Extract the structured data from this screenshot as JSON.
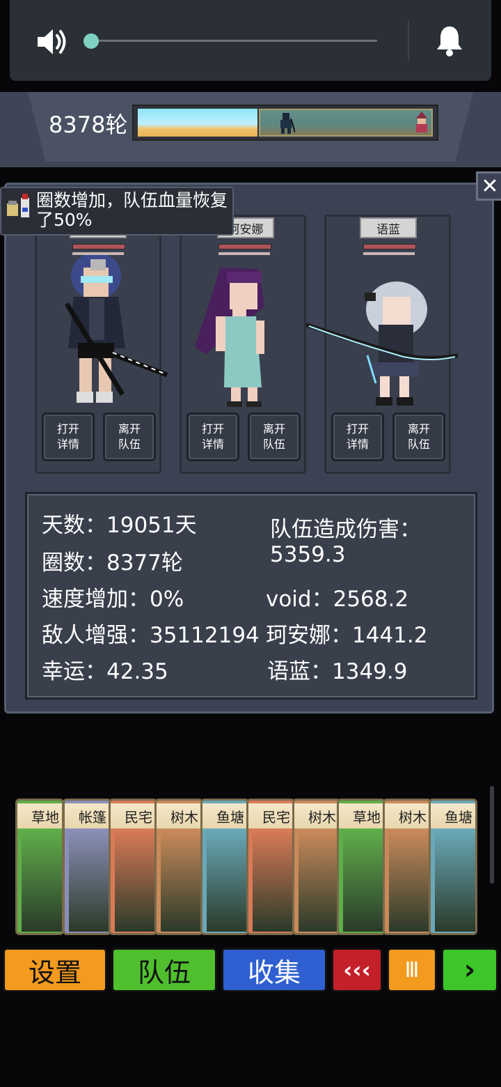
{
  "volume": {
    "level": 0.02
  },
  "round": {
    "label": "8378轮",
    "progress": 0.4
  },
  "notification": {
    "text": "圈数增加，队伍血量恢复了50%"
  },
  "team": {
    "members": [
      {
        "name": "",
        "open_label": "打开\n详情",
        "leave_label": "离开\n队伍"
      },
      {
        "name": "珂安娜",
        "open_label": "打开\n详情",
        "leave_label": "离开\n队伍"
      },
      {
        "name": "语蓝",
        "open_label": "打开\n详情",
        "leave_label": "离开\n队伍"
      }
    ]
  },
  "stats": {
    "days": "天数：19051天",
    "laps": "圈数：8377轮",
    "speed": "速度增加：0%",
    "enemy_boost": "敌人增强：35112194",
    "luck": "幸运：42.35",
    "team_damage_title": "队伍造成伤害：",
    "team_damage_value": "5359.3",
    "void_damage": "void：2568.2",
    "keanna_damage": "珂安娜：1441.2",
    "yulan_damage": "语蓝：1349.9"
  },
  "cards": [
    {
      "label": "草地",
      "color": "#5fae4a"
    },
    {
      "label": "帐篷",
      "color": "#8b8fb8"
    },
    {
      "label": "民宅",
      "color": "#d97a57"
    },
    {
      "label": "树木",
      "color": "#c98a5a"
    },
    {
      "label": "鱼塘",
      "color": "#6aa8b8"
    },
    {
      "label": "民宅",
      "color": "#d97a57"
    },
    {
      "label": "树木",
      "color": "#c98a5a"
    },
    {
      "label": "草地",
      "color": "#5fae4a"
    },
    {
      "label": "树木",
      "color": "#c98a5a"
    },
    {
      "label": "鱼塘",
      "color": "#6aa8b8"
    }
  ],
  "bottom_bar": {
    "settings": "设置",
    "team": "队伍",
    "collect": "收集",
    "rewind": "‹‹‹",
    "pause": "Ⅲ",
    "play": "›",
    "colors": {
      "settings": "#f39a1f",
      "team": "#4fbf2e",
      "collect": "#2f5fd0",
      "rewind": "#c4202a",
      "pause": "#f39a1f",
      "play": "#3cc62a"
    }
  }
}
